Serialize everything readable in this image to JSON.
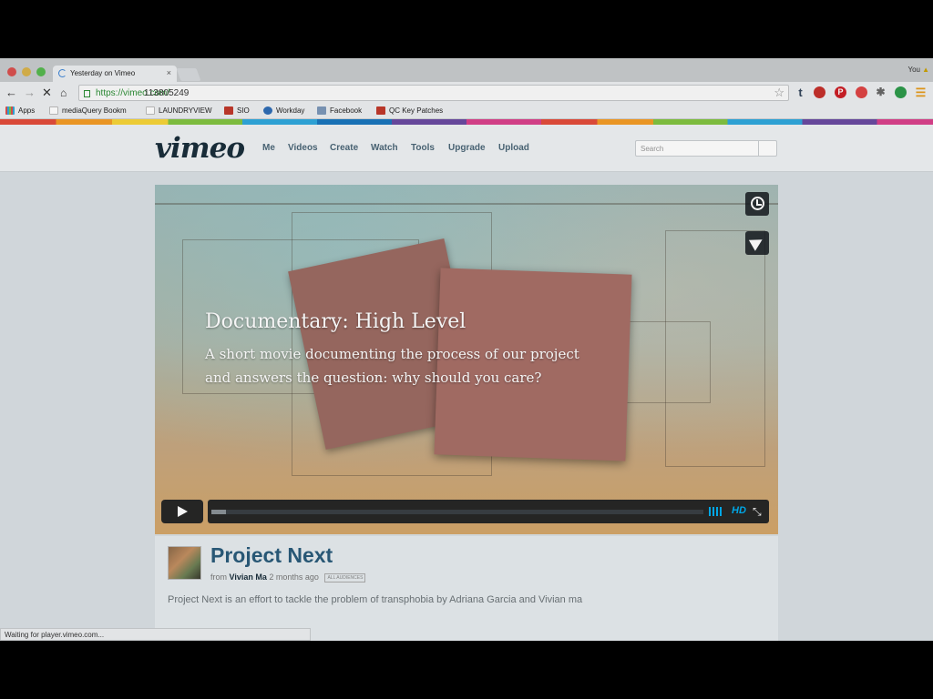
{
  "browser": {
    "tab_title": "Yesterday on Vimeo",
    "tab_close": "×",
    "profile": "You",
    "profile_warning": "▲",
    "url_scheme": "https://vimeo.com/",
    "url_path": "113805249",
    "status_text": "Waiting for player.vimeo.com..."
  },
  "bookmarks": [
    {
      "label": "Apps",
      "icon": "apps-grid-icon",
      "color": "#d9514f"
    },
    {
      "label": "mediaQuery Bookm",
      "icon": "page-icon",
      "color": "#cccccc"
    },
    {
      "label": "LAUNDRYVIEW",
      "icon": "page-icon",
      "color": "#cccccc"
    },
    {
      "label": "SIO",
      "icon": "sio-icon",
      "color": "#c0392b"
    },
    {
      "label": "Workday",
      "icon": "workday-icon",
      "color": "#2f6db5"
    },
    {
      "label": "Facebook",
      "icon": "folder-icon",
      "color": "#7c97b9"
    },
    {
      "label": "QC Key Patches",
      "icon": "qc-icon",
      "color": "#c0392b"
    }
  ],
  "vimeo": {
    "logo": "vimeo",
    "nav": [
      "Me",
      "Videos",
      "Create",
      "Watch",
      "Tools",
      "Upgrade",
      "Upload"
    ],
    "search_placeholder": "Search"
  },
  "video": {
    "title": "Documentary: High Level",
    "description": "A short movie documenting the process of our project and answers the question: why should you care?",
    "progress": 0.03,
    "hd_label": "HD",
    "fullscreen_glyph": "⤡"
  },
  "clip": {
    "title": "Project Next",
    "from_label": "from",
    "user": "Vivian Ma",
    "time_ago": "2 months ago",
    "badge": "ALL AUDIENCES",
    "description": "Project Next is an effort to tackle the problem of transphobia by Adriana Garcia and Vivian ma"
  },
  "colors": {
    "vimeo_blue": "#00adef",
    "link_blue": "#2a5b7a",
    "secure_green": "#2c8d35"
  }
}
